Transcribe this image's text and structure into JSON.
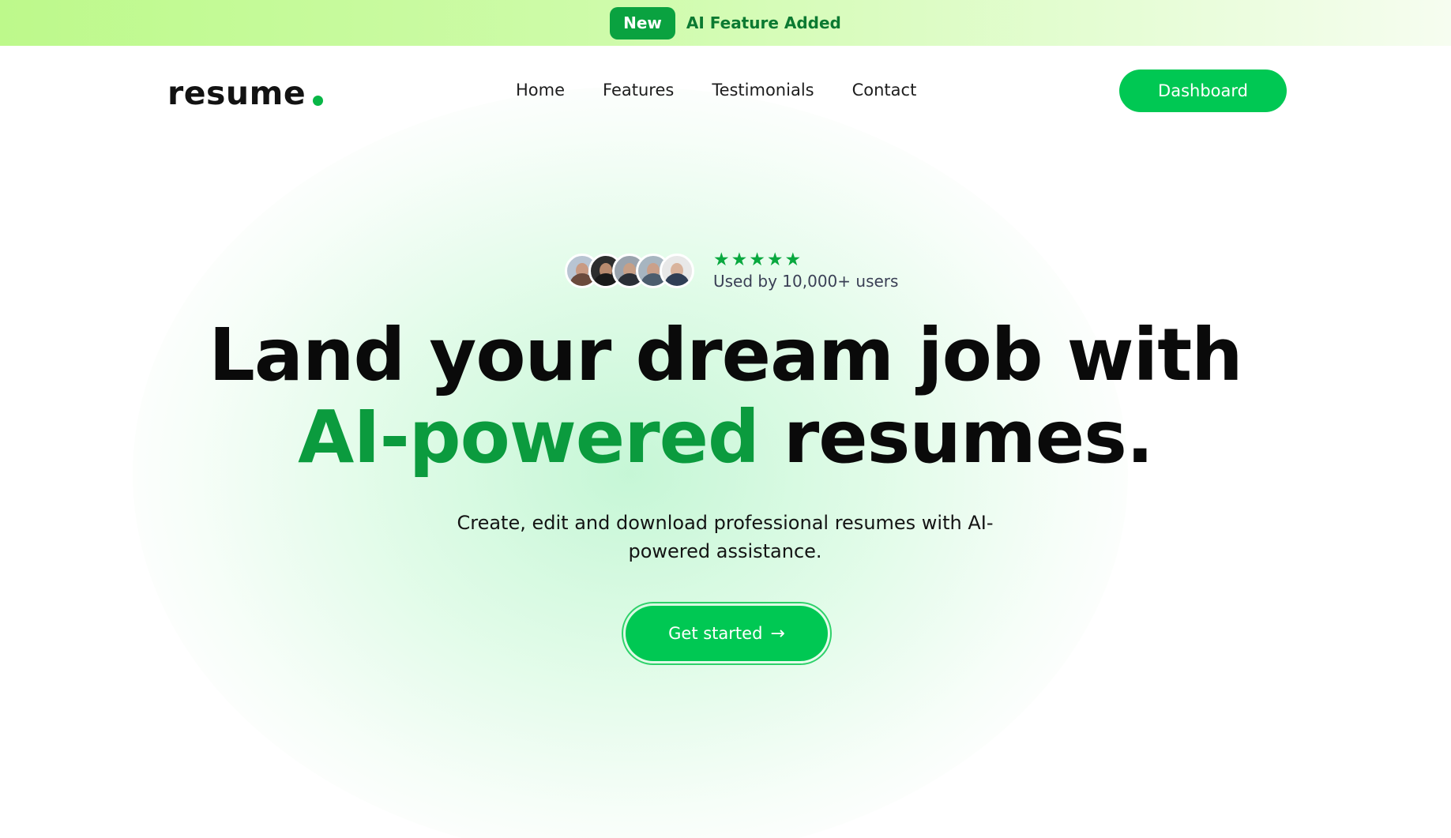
{
  "announcement": {
    "badge": "New",
    "message": "AI Feature Added"
  },
  "header": {
    "logo": "resume",
    "nav": [
      "Home",
      "Features",
      "Testimonials",
      "Contact"
    ],
    "dashboard_label": "Dashboard"
  },
  "social_proof": {
    "rating_stars": 5,
    "label": "Used by 10,000+ users"
  },
  "hero": {
    "headline_line1": "Land your dream job with",
    "headline_accent": "AI-powered",
    "headline_rest": "resumes.",
    "subtitle": "Create, edit and download professional resumes with AI-powered assistance.",
    "cta_label": "Get started"
  },
  "colors": {
    "brand_green": "#00c853",
    "accent_text_green": "#0b9b3e",
    "badge_green": "#0aa240"
  }
}
